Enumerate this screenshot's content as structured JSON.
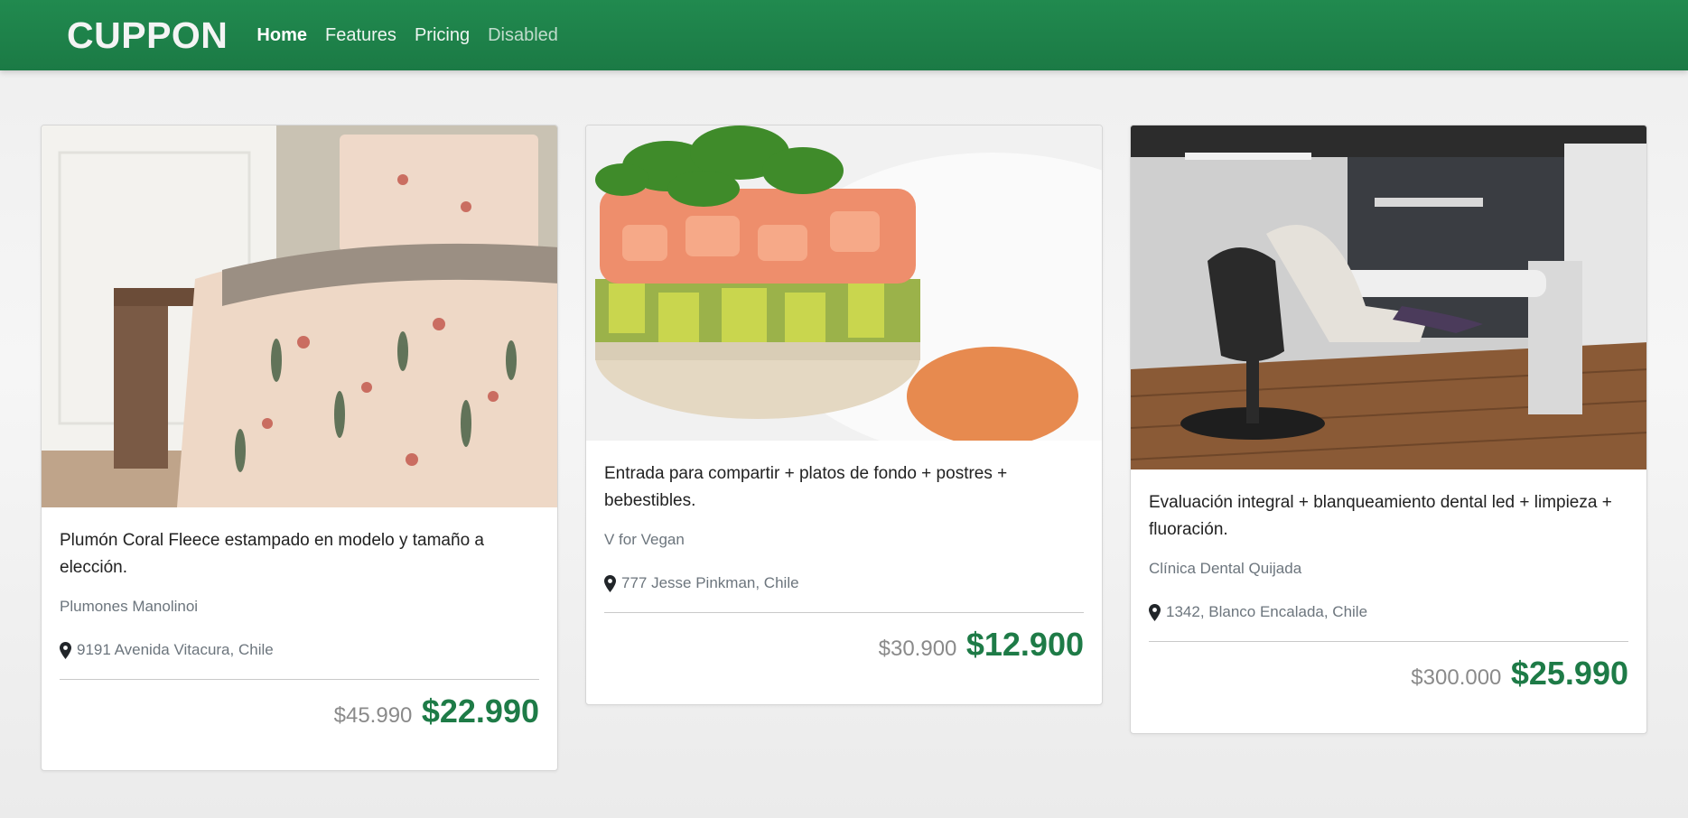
{
  "navbar": {
    "brand": "CUPPON",
    "links": [
      {
        "label": "Home"
      },
      {
        "label": "Features"
      },
      {
        "label": "Pricing"
      },
      {
        "label": "Disabled"
      }
    ]
  },
  "cards": [
    {
      "image_alt": "bed with floral comforter",
      "title": "Plumón Coral Fleece estampado en modelo y tamaño a elección.",
      "merchant": "Plumones Manolinoi",
      "location": "9191 Avenida Vitacura, Chile",
      "old_price": "$45.990",
      "new_price": "$22.990"
    },
    {
      "image_alt": "salmon avocado quinoa tartare",
      "title": "Entrada para compartir + platos de fondo + postres + bebestibles.",
      "merchant": "V for Vegan",
      "location": "777 Jesse Pinkman, Chile",
      "old_price": "$30.900",
      "new_price": "$12.900"
    },
    {
      "image_alt": "dental clinic chair",
      "title": "Evaluación integral + blanqueamiento dental led + limpieza + fluoración.",
      "merchant": "Clínica Dental Quijada",
      "location": "1342, Blanco Encalada, Chile",
      "old_price": "$300.000",
      "new_price": "$25.990"
    }
  ],
  "colors": {
    "navbar": "#1f8049",
    "accent_price": "#1e7b47"
  }
}
